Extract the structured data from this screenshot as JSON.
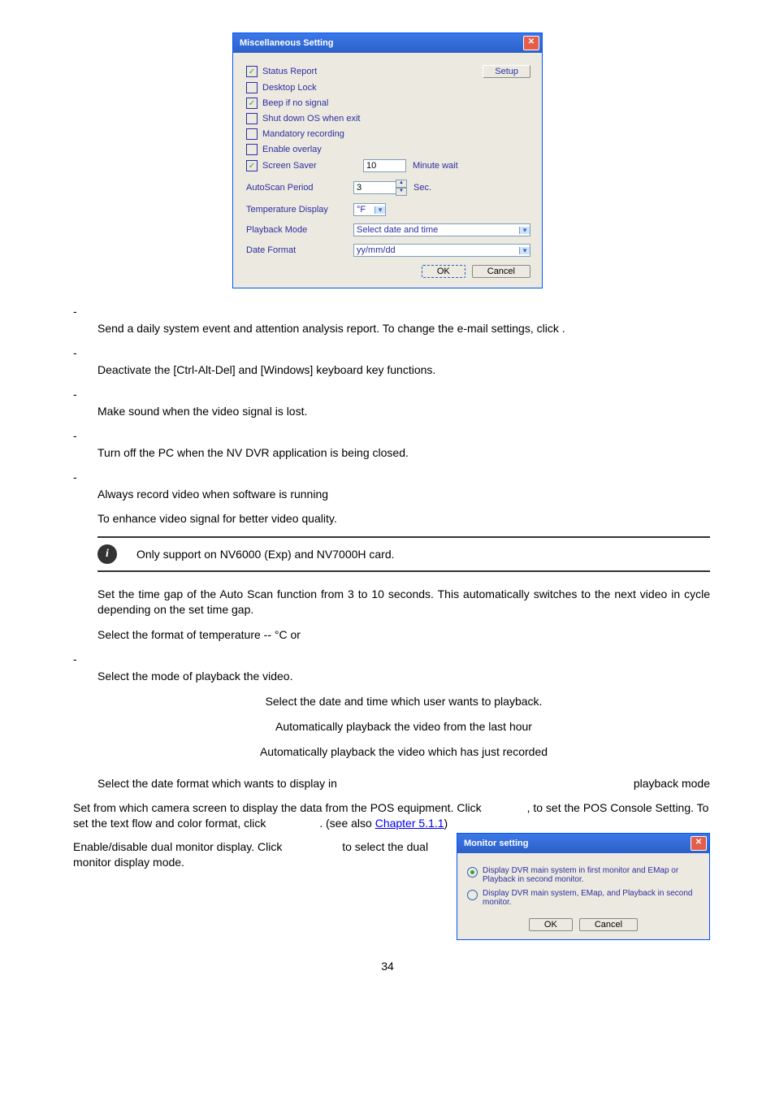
{
  "dialog1": {
    "title": "Miscellaneous Setting",
    "checkboxes": {
      "status_report": {
        "label": "Status Report",
        "checked": true
      },
      "desktop_lock": {
        "label": "Desktop Lock",
        "checked": false
      },
      "beep": {
        "label": "Beep if no signal",
        "checked": true
      },
      "shutdown": {
        "label": "Shut down OS when exit",
        "checked": false
      },
      "mandatory": {
        "label": "Mandatory recording",
        "checked": false
      },
      "overlay": {
        "label": "Enable overlay",
        "checked": false
      },
      "screensaver": {
        "label": "Screen Saver",
        "checked": true
      }
    },
    "setup_btn": "Setup",
    "screensaver_value": "10",
    "screensaver_unit": "Minute wait",
    "autoscan_label": "AutoScan Period",
    "autoscan_value": "3",
    "autoscan_unit": "Sec.",
    "temp_label": "Temperature Display",
    "temp_value": "°F",
    "playback_label": "Playback Mode",
    "playback_value": "Select date and time",
    "date_label": "Date Format",
    "date_value": "yy/mm/dd",
    "ok": "OK",
    "cancel": "Cancel"
  },
  "body": {
    "status_report_desc1": "Send a daily system event and attention analysis report. To change the e-mail settings, click",
    "status_report_desc2": ".",
    "desktop_lock_desc": "Deactivate the [Ctrl-Alt-Del] and [Windows] keyboard key functions.",
    "beep_desc": "Make sound when the video signal is lost.",
    "shutdown_desc": "Turn off the PC when the NV DVR application is being closed.",
    "mandatory_desc": "Always record video when software is running",
    "overlay_desc": "To enhance video signal for better video quality.",
    "info_note": "Only support on NV6000 (Exp) and NV7000H card.",
    "autoscan_desc": "Set the time gap of the Auto Scan function from 3 to 10 seconds. This automatically switches to the next video in cycle depending on the set time gap.",
    "temp_desc": "Select the format of temperature -- °C or",
    "playback_desc": "Select the mode of playback the video.",
    "playback_opt1": "Select the date and time which user wants to playback.",
    "playback_opt2": "Automatically playback the video from the last hour",
    "playback_opt3": "Automatically playback the video which has just recorded",
    "date_desc1": "Select the date format which wants to display in",
    "date_desc2": "playback mode",
    "pos_desc1": "Set from which camera screen to display the data from the POS equipment. Click",
    "pos_desc2": ", to set the POS Console Setting. To set the text flow and color format, click",
    "pos_desc3": ". (see also",
    "chapter_link": "Chapter 5.1.1",
    "pos_desc4": ")",
    "dual_desc1": "Enable/disable dual monitor display. Click",
    "dual_desc2": "to select the dual monitor display mode."
  },
  "dialog2": {
    "title": "Monitor setting",
    "option1": "Display DVR main system in first monitor and EMap or Playback in second monitor.",
    "option2": "Display DVR main system, EMap, and Playback in second monitor.",
    "ok": "OK",
    "cancel": "Cancel"
  },
  "page_number": "34"
}
